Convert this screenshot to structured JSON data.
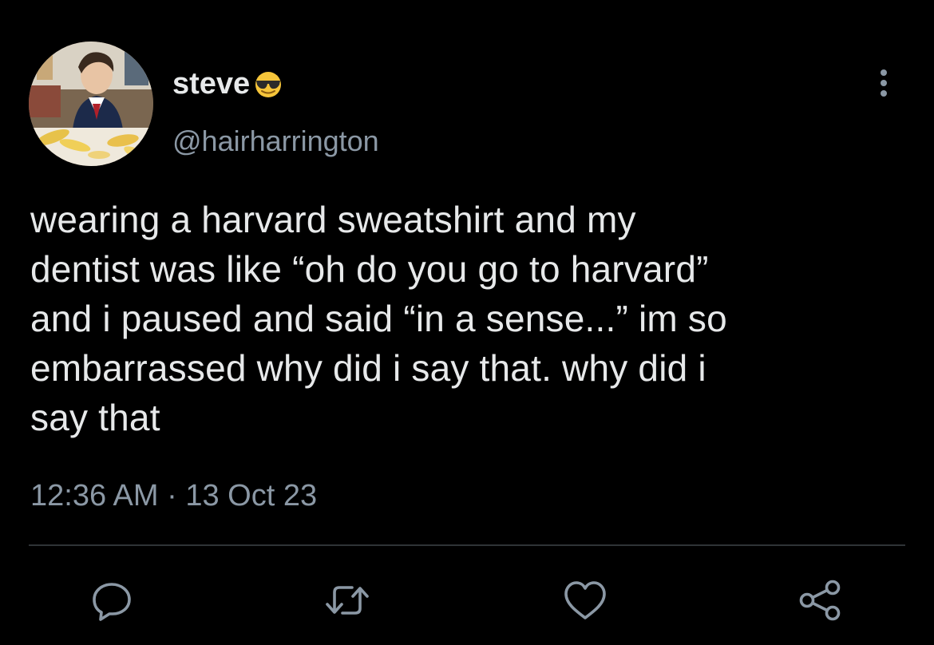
{
  "user": {
    "display_name": "steve",
    "display_name_emoji": "smiling-face-with-sunglasses-icon",
    "handle": "@hairharrington"
  },
  "tweet": {
    "text": "wearing a harvard sweatshirt and my\ndentist was like “oh do you go to harvard”\nand i paused and said “in a sense...” im so\nembarrassed why did i say that. why did i\nsay that",
    "timestamp": "12:36 AM · 13 Oct 23"
  },
  "actions": [
    {
      "name": "reply",
      "icon": "reply-icon"
    },
    {
      "name": "retweet",
      "icon": "retweet-icon"
    },
    {
      "name": "like",
      "icon": "heart-icon"
    },
    {
      "name": "share",
      "icon": "share-icon"
    }
  ],
  "colors": {
    "background": "#000000",
    "primary_text": "#e7e9ea",
    "secondary_text": "#8b98a5",
    "divider": "#2f3336"
  }
}
